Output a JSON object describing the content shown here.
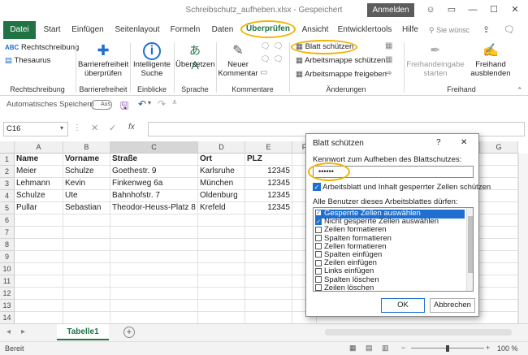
{
  "titlebar": {
    "title": "Schreibschutz_aufheben.xlsx  -  Gespeichert",
    "signin": "Anmelden"
  },
  "menu": [
    "Datei",
    "Start",
    "Einfügen",
    "Seitenlayout",
    "Formeln",
    "Daten",
    "Überprüfen",
    "Ansicht",
    "Entwicklertools",
    "Hilfe"
  ],
  "search_placeholder": "Sie wünsc",
  "ribbon": {
    "rechtschreibung": "Rechtschreibung",
    "thesaurus": "Thesaurus",
    "grp_rechtschreibung": "Rechtschreibung",
    "barriere": [
      "Barrierefreiheit",
      "überprüfen"
    ],
    "grp_barriere": "Barrierefreiheit",
    "intelligente": [
      "Intelligente",
      "Suche"
    ],
    "grp_einblicke": "Einblicke",
    "uebersetzen": "Übersetzen",
    "grp_sprache": "Sprache",
    "neuer_kommentar": [
      "Neuer",
      "Kommentar"
    ],
    "grp_kommentare": "Kommentare",
    "blatt_schuetzen": "Blatt schützen",
    "arbeitsmappe_schuetzen": "Arbeitsmappe schützen",
    "arbeitsmappe_freigeben": "Arbeitsmappe freigeben",
    "grp_aenderungen": "Änderungen",
    "freihandeingabe": [
      "Freihandeingabe",
      "starten"
    ],
    "freihand_ausblenden": [
      "Freihand",
      "ausblenden"
    ],
    "grp_freihand": "Freihand"
  },
  "qa": {
    "autosave": "Automatisches Speichern",
    "toggle": "Aus"
  },
  "formula": {
    "namebox": "C16",
    "fx": "fx"
  },
  "columns": [
    "A",
    "B",
    "C",
    "D",
    "E",
    "F",
    "G"
  ],
  "rows": [
    [
      "Name",
      "Vorname",
      "Straße",
      "Ort",
      "PLZ"
    ],
    [
      "Meier",
      "Schulze",
      "Goethestr. 9",
      "Karlsruhe",
      "12345"
    ],
    [
      "Lehmann",
      "Kevin",
      "Finkenweg 6a",
      "München",
      "12345"
    ],
    [
      "Schulze",
      "Ute",
      "Bahnhofstr. 7",
      "Oldenburg",
      "12345"
    ],
    [
      "Pullar",
      "Sebastian",
      "Theodor-Heuss-Platz 8",
      "Krefeld",
      "12345"
    ]
  ],
  "rownums": [
    "1",
    "2",
    "3",
    "4",
    "5",
    "6",
    "7",
    "8",
    "9",
    "10",
    "11",
    "12",
    "13",
    "14"
  ],
  "sheet": {
    "tab": "Tabelle1",
    "add": "+"
  },
  "status": {
    "left": "Bereit",
    "zoom": "100 %"
  },
  "dialog": {
    "title": "Blatt schützen",
    "help": "?",
    "close": "✕",
    "pw_label": "Kennwort zum Aufheben des Blattschutzes:",
    "pw_value": "••••••",
    "protect_label": "Arbeitsblatt und Inhalt gesperrter Zellen schützen",
    "list_label": "Alle Benutzer dieses Arbeitsblattes dürfen:",
    "items": [
      {
        "label": "Gesperrte Zellen auswählen",
        "checked": true
      },
      {
        "label": "Nicht gesperrte Zellen auswählen",
        "checked": true
      },
      {
        "label": "Zeilen formatieren",
        "checked": false
      },
      {
        "label": "Spalten formatieren",
        "checked": false
      },
      {
        "label": "Zellen formatieren",
        "checked": false
      },
      {
        "label": "Spalten einfügen",
        "checked": false
      },
      {
        "label": "Zeilen einfügen",
        "checked": false
      },
      {
        "label": "Links einfügen",
        "checked": false
      },
      {
        "label": "Spalten löschen",
        "checked": false
      },
      {
        "label": "Zeilen löschen",
        "checked": false
      }
    ],
    "ok": "OK",
    "cancel": "Abbrechen"
  },
  "colors": {
    "excel_green": "#217346",
    "highlight": "#f0b400",
    "select_blue": "#1e6fcf"
  }
}
